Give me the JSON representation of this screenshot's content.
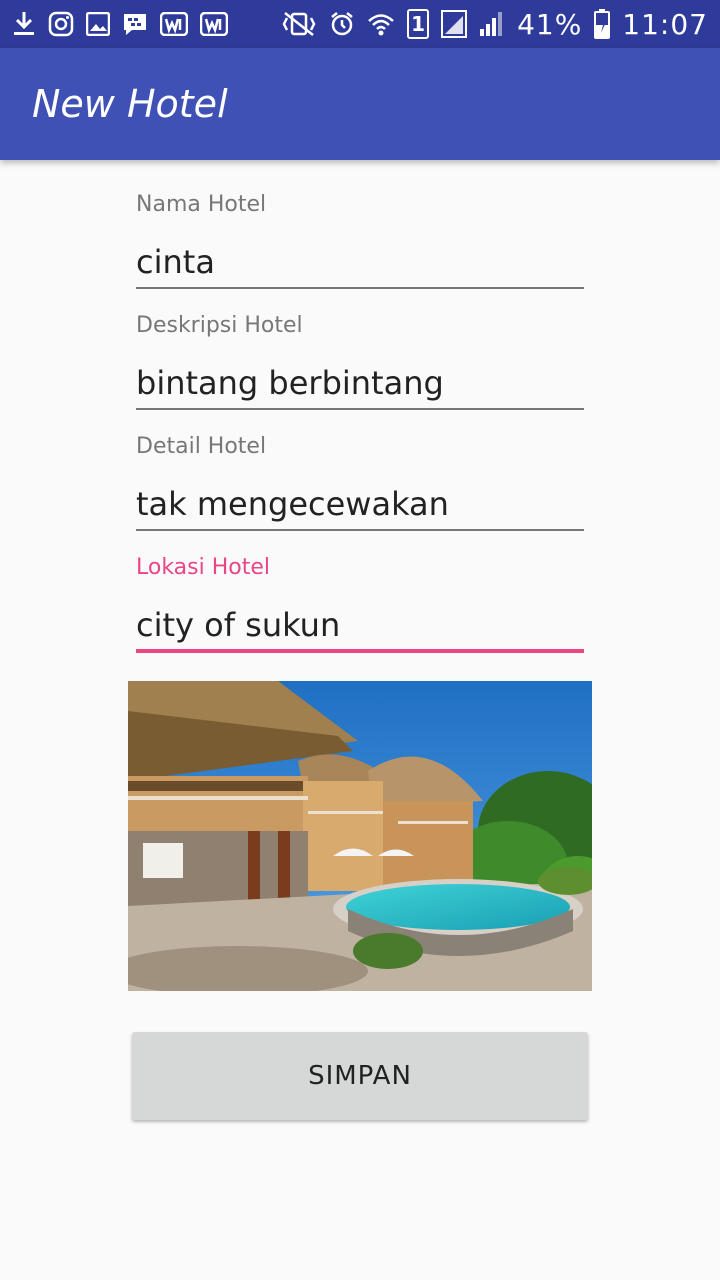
{
  "status_bar": {
    "left_icons": [
      "download-icon",
      "instagram-icon",
      "image-icon",
      "bbm-icon",
      "webtoon-icon",
      "webtoon-icon"
    ],
    "right_icons": [
      "vibrate-icon",
      "alarm-icon",
      "wifi-icon",
      "sim1-icon",
      "signal-box-icon",
      "signal-icon",
      "battery-charging-icon"
    ],
    "sim_label": "1",
    "battery": "41%",
    "time": "11:07"
  },
  "app_bar": {
    "title": "New Hotel"
  },
  "form": {
    "fields": [
      {
        "label": "Nama Hotel",
        "value": "cinta"
      },
      {
        "label": "Deskripsi Hotel",
        "value": "bintang berbintang"
      },
      {
        "label": "Detail Hotel",
        "value": "tak mengecewakan"
      },
      {
        "label": "Lokasi Hotel",
        "value": "city of sukun"
      }
    ],
    "focused_field_color": "#e94684"
  },
  "save_button": {
    "label": "SIMPAN"
  },
  "colors": {
    "status_bar": "#2f3b9a",
    "app_bar": "#3f51b5",
    "accent": "#e94684",
    "background": "#fafafa"
  }
}
